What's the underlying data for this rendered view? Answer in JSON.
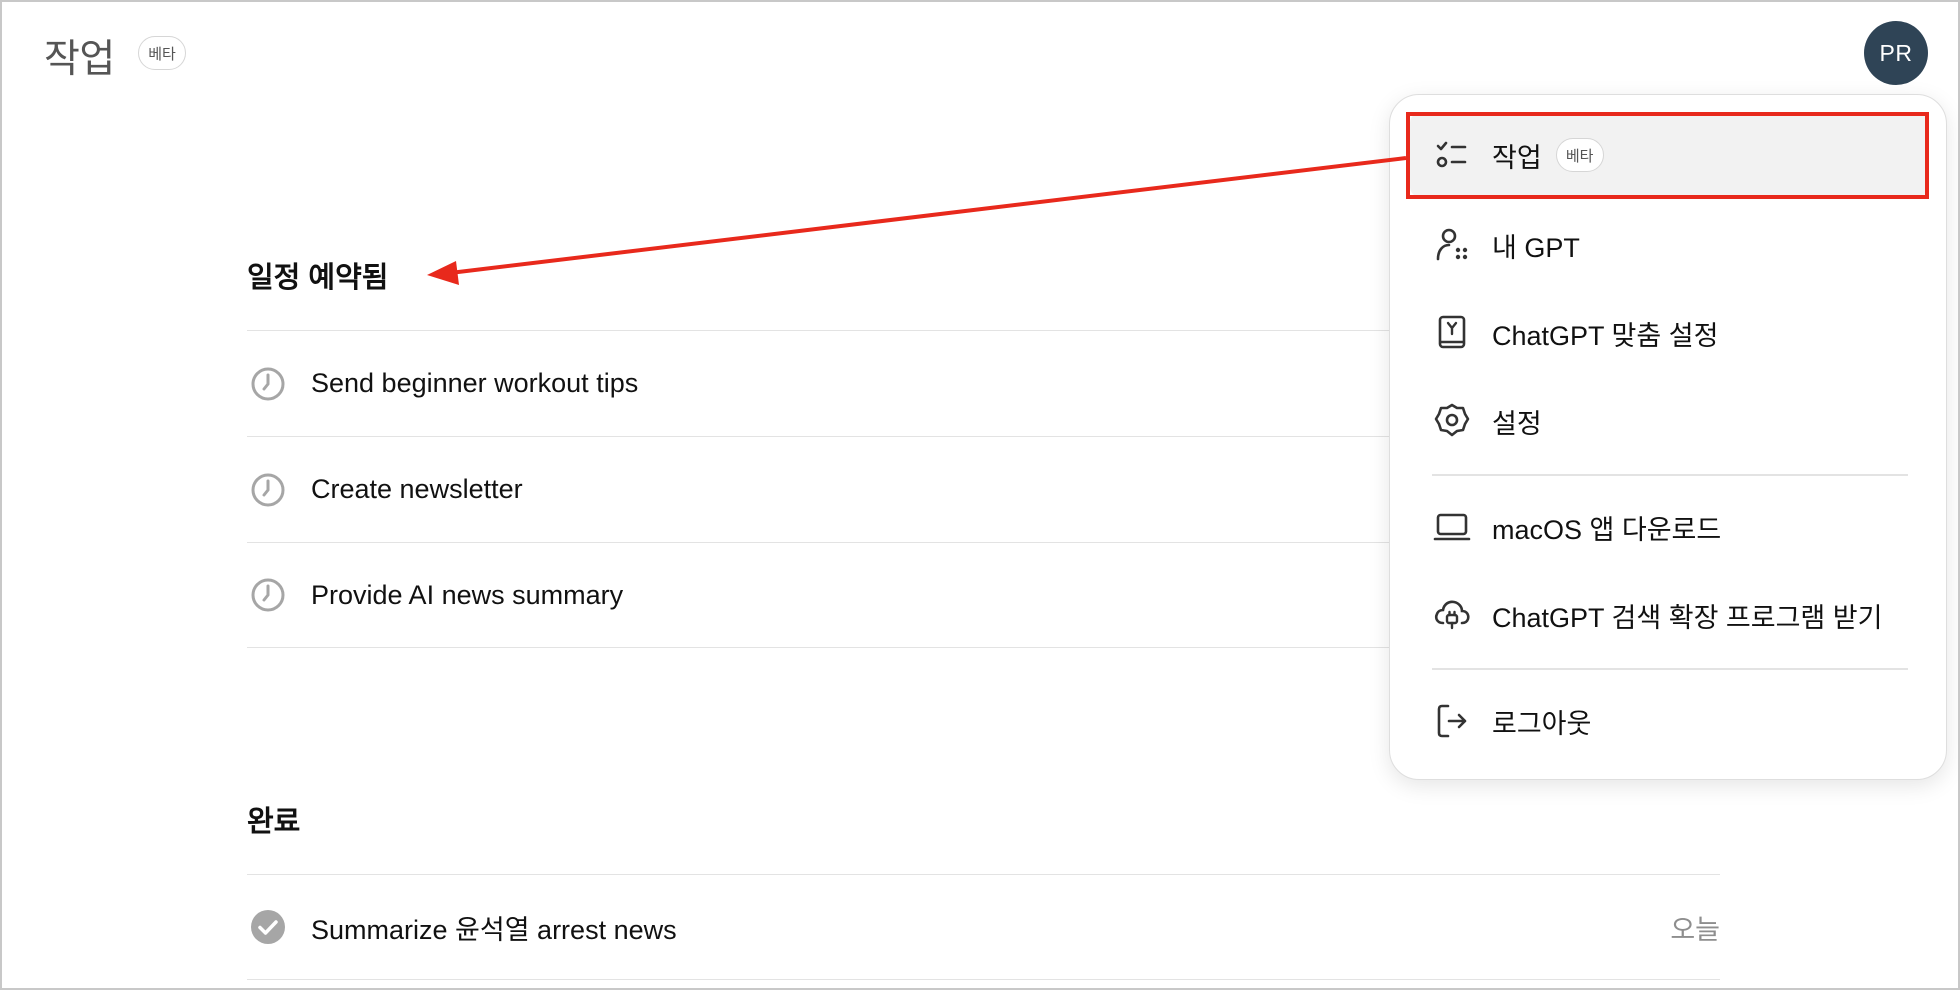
{
  "header": {
    "title": "작업",
    "badge": "베타",
    "avatar_initials": "PR"
  },
  "scheduled": {
    "heading": "일정 예약됨",
    "tasks": [
      {
        "title": "Send beginner workout tips",
        "icon": "clock-icon"
      },
      {
        "title": "Create newsletter",
        "icon": "clock-icon"
      },
      {
        "title": "Provide AI news summary",
        "icon": "clock-icon"
      }
    ]
  },
  "completed": {
    "heading": "완료",
    "tasks": [
      {
        "title": "Summarize 윤석열 arrest news",
        "date": "오늘",
        "icon": "check-circle-icon"
      }
    ]
  },
  "menu": {
    "items": [
      {
        "label": "작업",
        "badge": "베타",
        "icon": "tasks-icon",
        "active": true
      },
      {
        "label": "내 GPT",
        "icon": "my-gpts-icon"
      },
      {
        "label": "ChatGPT 맞춤 설정",
        "icon": "customize-icon"
      },
      {
        "label": "설정",
        "icon": "gear-icon"
      },
      {
        "label": "macOS 앱 다운로드",
        "icon": "laptop-icon"
      },
      {
        "label": "ChatGPT 검색 확장 프로그램 받기",
        "icon": "extension-icon"
      },
      {
        "label": "로그아웃",
        "icon": "logout-icon"
      }
    ]
  },
  "colors": {
    "annotation": "#e8291c",
    "avatar": "#2f4456",
    "active_item": "#f2f2f2"
  }
}
